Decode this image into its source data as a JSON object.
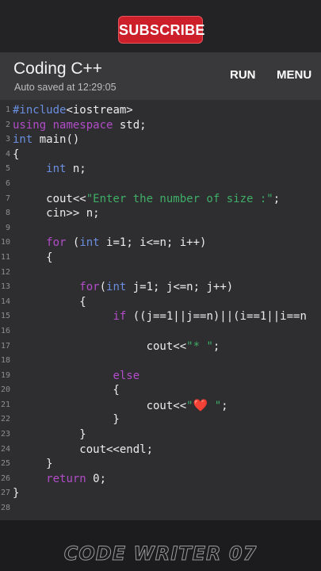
{
  "overlay": {
    "subscribe_label": "SUBSCRIBE",
    "watermark": "CODE WRITER 07"
  },
  "app": {
    "title": "Coding C++",
    "autosave": "Auto saved at 12:29:05",
    "run_label": "RUN",
    "menu_label": "MENU"
  },
  "editor": {
    "line_numbers": [
      "1",
      "2",
      "3",
      "4",
      "5",
      "6",
      "7",
      "8",
      "9",
      "10",
      "11",
      "12",
      "13",
      "14",
      "15",
      "16",
      "17",
      "18",
      "19",
      "20",
      "21",
      "22",
      "23",
      "24",
      "25",
      "26",
      "27",
      "28"
    ],
    "lines": [
      [
        {
          "t": "#include",
          "c": "pp"
        },
        {
          "t": "<iostream>",
          "c": "plain"
        }
      ],
      [
        {
          "t": "using",
          "c": "kw2"
        },
        {
          "t": " ",
          "c": "plain"
        },
        {
          "t": "namespace",
          "c": "kw2"
        },
        {
          "t": " std;",
          "c": "plain"
        }
      ],
      [
        {
          "t": "int",
          "c": "kw"
        },
        {
          "t": " main()",
          "c": "plain"
        }
      ],
      [
        {
          "t": "{",
          "c": "plain"
        }
      ],
      [
        {
          "t": "     ",
          "c": "plain"
        },
        {
          "t": "int",
          "c": "kw"
        },
        {
          "t": " n;",
          "c": "plain"
        }
      ],
      [],
      [
        {
          "t": "     cout<<",
          "c": "plain"
        },
        {
          "t": "\"Enter the number of size :\"",
          "c": "str"
        },
        {
          "t": ";",
          "c": "plain"
        }
      ],
      [
        {
          "t": "     cin>> n;",
          "c": "plain"
        }
      ],
      [],
      [
        {
          "t": "     ",
          "c": "plain"
        },
        {
          "t": "for",
          "c": "kw2"
        },
        {
          "t": " (",
          "c": "plain"
        },
        {
          "t": "int",
          "c": "kw"
        },
        {
          "t": " i=1; i<=n; i++)",
          "c": "plain"
        }
      ],
      [
        {
          "t": "     {",
          "c": "plain"
        }
      ],
      [],
      [
        {
          "t": "          ",
          "c": "plain"
        },
        {
          "t": "for",
          "c": "kw2"
        },
        {
          "t": "(",
          "c": "plain"
        },
        {
          "t": "int",
          "c": "kw"
        },
        {
          "t": " j=1; j<=n; j++)",
          "c": "plain"
        }
      ],
      [
        {
          "t": "          {",
          "c": "plain"
        }
      ],
      [
        {
          "t": "               ",
          "c": "plain"
        },
        {
          "t": "if",
          "c": "kw2"
        },
        {
          "t": " ((j==1||j==n)||(i==1||i==n",
          "c": "plain"
        }
      ],
      [],
      [
        {
          "t": "                    cout<<",
          "c": "plain"
        },
        {
          "t": "\"* \"",
          "c": "str"
        },
        {
          "t": ";",
          "c": "plain"
        }
      ],
      [],
      [
        {
          "t": "               ",
          "c": "plain"
        },
        {
          "t": "else",
          "c": "kw2"
        }
      ],
      [
        {
          "t": "               {",
          "c": "plain"
        }
      ],
      [
        {
          "t": "                    cout<<",
          "c": "plain"
        },
        {
          "t": "\"",
          "c": "str"
        },
        {
          "t": "❤️",
          "c": "heart"
        },
        {
          "t": " \"",
          "c": "str"
        },
        {
          "t": ";",
          "c": "plain"
        }
      ],
      [
        {
          "t": "               }",
          "c": "plain"
        }
      ],
      [
        {
          "t": "          }",
          "c": "plain"
        }
      ],
      [
        {
          "t": "          cout<<endl;",
          "c": "plain"
        }
      ],
      [
        {
          "t": "     }",
          "c": "plain"
        }
      ],
      [
        {
          "t": "     ",
          "c": "plain"
        },
        {
          "t": "return",
          "c": "kw2"
        },
        {
          "t": " 0;",
          "c": "plain"
        }
      ],
      [
        {
          "t": "}",
          "c": "plain"
        }
      ],
      []
    ]
  }
}
